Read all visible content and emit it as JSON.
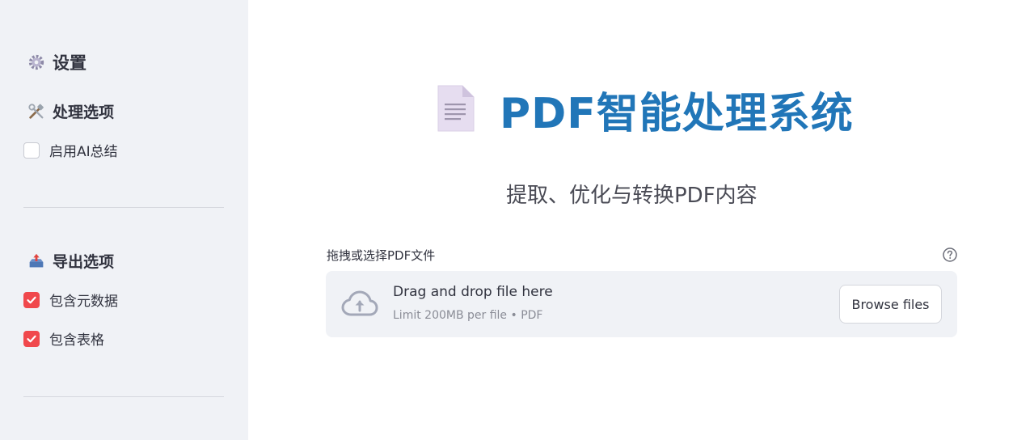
{
  "sidebar": {
    "settings_title": "设置",
    "settings_icon": "gear-icon",
    "processing": {
      "title": "处理选项",
      "icon": "tools-icon",
      "options": [
        {
          "label": "启用AI总结",
          "checked": false
        }
      ]
    },
    "export": {
      "title": "导出选项",
      "icon": "outbox-tray-icon",
      "options": [
        {
          "label": "包含元数据",
          "checked": true
        },
        {
          "label": "包含表格",
          "checked": true
        }
      ]
    }
  },
  "main": {
    "title": "PDF智能处理系统",
    "title_icon": "document-icon",
    "subtitle": "提取、优化与转换PDF内容",
    "uploader": {
      "label": "拖拽或选择PDF文件",
      "drop_text": "Drag and drop file here",
      "limit_text": "Limit 200MB per file • PDF",
      "browse_label": "Browse files"
    }
  },
  "colors": {
    "accent_checkbox": "#f0484c",
    "title_blue": "#2176b8",
    "sidebar_bg": "#f0f2f6"
  }
}
